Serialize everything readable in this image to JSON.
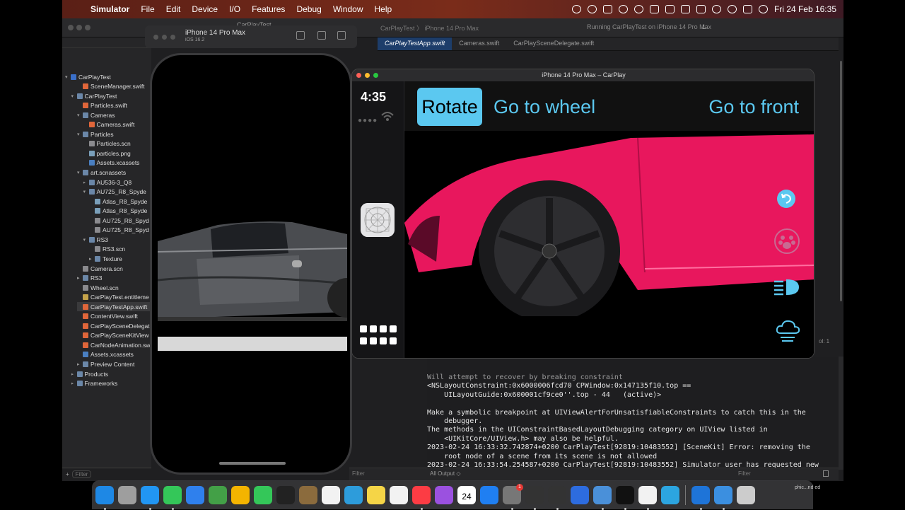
{
  "menubar": {
    "app_name": "Simulator",
    "menus": [
      "File",
      "Edit",
      "Device",
      "I/O",
      "Features",
      "Debug",
      "Window",
      "Help"
    ],
    "clock": "Fri 24 Feb  16:35"
  },
  "xcode": {
    "project_title": "CarPlayTest",
    "breadcrumb": "CarPlayTest 〉 iPhone 14 Pro Max",
    "status": "Running CarPlayTest on iPhone 14 Pro Max",
    "issue_count": "1",
    "tabs": [
      "CarPlayTestApp.swift",
      "Cameras.swift",
      "CarPlaySceneDelegate.swift"
    ],
    "column_label": "ol: 1",
    "navigator": [
      {
        "label": "CarPlayTest",
        "indent": 0,
        "icon": "proj",
        "chev": "v"
      },
      {
        "label": "SceneManager.swift",
        "indent": 2,
        "icon": "swift",
        "chev": ""
      },
      {
        "label": "CarPlayTest",
        "indent": 1,
        "icon": "folder",
        "chev": "v"
      },
      {
        "label": "Particles.swift",
        "indent": 2,
        "icon": "swift",
        "chev": ""
      },
      {
        "label": "Cameras",
        "indent": 2,
        "icon": "folder",
        "chev": "v"
      },
      {
        "label": "Cameras.swift",
        "indent": 3,
        "icon": "swift",
        "chev": ""
      },
      {
        "label": "Particles",
        "indent": 2,
        "icon": "folder",
        "chev": "v"
      },
      {
        "label": "Particles.scn",
        "indent": 3,
        "icon": "scn",
        "chev": ""
      },
      {
        "label": "particles.png",
        "indent": 3,
        "icon": "img",
        "chev": ""
      },
      {
        "label": "Assets.xcassets",
        "indent": 3,
        "icon": "asset",
        "chev": ""
      },
      {
        "label": "art.scnassets",
        "indent": 2,
        "icon": "folder",
        "chev": "v"
      },
      {
        "label": "AU536-3_Q8",
        "indent": 3,
        "icon": "folder",
        "chev": ">"
      },
      {
        "label": "AU725_R8_Spyde",
        "indent": 3,
        "icon": "folder",
        "chev": "v"
      },
      {
        "label": "Atlas_R8_Spyde",
        "indent": 4,
        "icon": "img",
        "chev": ""
      },
      {
        "label": "Atlas_R8_Spyde",
        "indent": 4,
        "icon": "img",
        "chev": ""
      },
      {
        "label": "AU725_R8_Spyd",
        "indent": 4,
        "icon": "scn",
        "chev": ""
      },
      {
        "label": "AU725_R8_Spyd",
        "indent": 4,
        "icon": "scn",
        "chev": ""
      },
      {
        "label": "RS3",
        "indent": 3,
        "icon": "folder",
        "chev": "v"
      },
      {
        "label": "RS3.scn",
        "indent": 4,
        "icon": "scn",
        "chev": ""
      },
      {
        "label": "Texture",
        "indent": 4,
        "icon": "folder",
        "chev": ">"
      },
      {
        "label": "Camera.scn",
        "indent": 2,
        "icon": "scn",
        "chev": ""
      },
      {
        "label": "RS3",
        "indent": 2,
        "icon": "folder",
        "chev": ">"
      },
      {
        "label": "Wheel.scn",
        "indent": 2,
        "icon": "scn",
        "chev": ""
      },
      {
        "label": "CarPlayTest.entitleme",
        "indent": 2,
        "icon": "ent",
        "chev": ""
      },
      {
        "label": "CarPlayTestApp.swift",
        "indent": 2,
        "icon": "swift",
        "chev": "",
        "selected": true
      },
      {
        "label": "ContentView.swift",
        "indent": 2,
        "icon": "swift",
        "chev": ""
      },
      {
        "label": "CarPlaySceneDelegat",
        "indent": 2,
        "icon": "swift",
        "chev": ""
      },
      {
        "label": "CarPlaySceneKitView",
        "indent": 2,
        "icon": "swift",
        "chev": ""
      },
      {
        "label": "CarNodeAnimation.sw",
        "indent": 2,
        "icon": "swift",
        "chev": ""
      },
      {
        "label": "Assets.xcassets",
        "indent": 2,
        "icon": "asset",
        "chev": ""
      },
      {
        "label": "Preview Content",
        "indent": 2,
        "icon": "folder",
        "chev": ">"
      },
      {
        "label": "Products",
        "indent": 1,
        "icon": "folder",
        "chev": ">"
      },
      {
        "label": "Frameworks",
        "indent": 1,
        "icon": "folder",
        "chev": ">"
      }
    ],
    "nav_filter": "Filter",
    "editor_filter": "Filter",
    "console_filter": "Filter",
    "output_selector": "All Output ◇",
    "console_lines": [
      "Will attempt to recover by breaking constraint",
      "<NSLayoutConstraint:0x6000006fcd70 CPWindow:0x147135f10.top ==",
      "    UILayoutGuide:0x600001cf9ce0''.top - 44   (active)>",
      "",
      "Make a symbolic breakpoint at UIViewAlertForUnsatisfiableConstraints to catch this in the",
      "    debugger.",
      "The methods in the UIConstraintBasedLayoutDebugging category on UIView listed in",
      "    <UIKitCore/UIView.h> may also be helpful.",
      "2023-02-24 16:33:32.742874+0200 CarPlayTest[92819:10483552] [SceneKit] Error: removing the",
      "    root node of a scene from its scene is not allowed",
      "2023-02-24 16:33:54.254587+0200 CarPlayTest[92819:10483552] Simulator user has requested new",
      "    graphics quality: 100"
    ]
  },
  "simulator": {
    "device_name": "iPhone 14 Pro Max",
    "os_version": "iOS 16.2"
  },
  "carplay": {
    "window_title": "iPhone 14 Pro Max – CarPlay",
    "time": "4:35",
    "buttons": {
      "rotate": "Rotate",
      "wheel": "Go to wheel",
      "front": "Go to front"
    },
    "right_icons": [
      "rotate-back-icon",
      "paw-icon",
      "headlight-icon",
      "cloud-icon"
    ],
    "colors": {
      "accent": "#5bc8f0",
      "car_body": "#e8175d"
    }
  },
  "dock": {
    "apps": [
      "finder",
      "launchpad",
      "safari",
      "messages",
      "mail",
      "maps",
      "photos",
      "facetime",
      "apple-tv",
      "wood-app",
      "reminders",
      "blue-app",
      "notes",
      "freeform",
      "music",
      "podcasts",
      "calendar",
      "app-store",
      "system-settings",
      "unity",
      "unity-hub",
      "location-app",
      "instruments",
      "terminal",
      "slack",
      "telegram",
      "xcode",
      "xcode-blue",
      "simulator-icon"
    ],
    "calendar_day": "24",
    "calendar_month": "FEB",
    "settings_badge": "1",
    "downloads_label": "phic...nd ed"
  }
}
